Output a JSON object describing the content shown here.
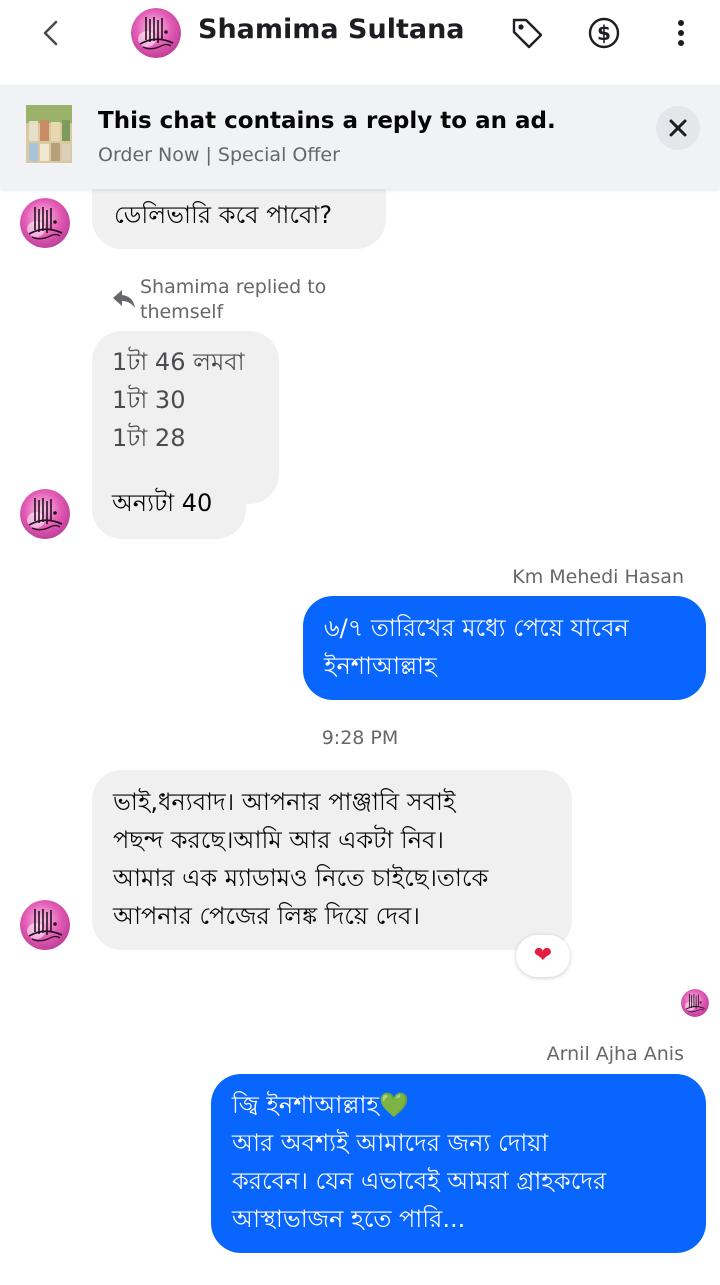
{
  "header": {
    "title": "Shamima Sultana",
    "icons": [
      "back-chevron-icon",
      "tag-icon",
      "dollar-icon",
      "more-vertical-icon"
    ]
  },
  "ad_banner": {
    "title": "This chat contains a reply to an ad.",
    "subtitle": "Order Now | Special Offer"
  },
  "messages": {
    "m1": {
      "text": "ডেলিভারি কবে পাবো?"
    },
    "reply_note": {
      "line1": "Shamima replied to",
      "line2": "themself"
    },
    "m2": {
      "line1": "1টা 46 লমবা",
      "line2": "1টা 30",
      "line3": "1টা 28"
    },
    "m3": {
      "text": "অন্যটা 40"
    },
    "sender_km": "Km Mehedi Hasan",
    "m4": {
      "line1": "৬/৭ তারিখের মধ্যে পেয়ে যাবেন",
      "line2": "ইনশাআল্লাহ"
    },
    "timestamp": "9:28 PM",
    "m5": {
      "line1": "ভাই,ধন্যবাদ। আপনার পাঞ্জাবি সবাই",
      "line2": "পছন্দ করছে।আমি আর একটা নিব।",
      "line3": "আমার এক ম্যাডামও নিতে চাইছে।তাকে",
      "line4": "আপনার পেজের লিঙ্ক দিয়ে দেব।"
    },
    "reaction": "❤",
    "sender_arnil": "Arnil Ajha Anis",
    "m6": {
      "line1": "জ্বি ইনশাআল্লাহ",
      "line1_emoji": "💚",
      "line2": "আর অবশ্যই আমাদের জন্য দোয়া",
      "line3": "করবেন। যেন এভাবেই আমরা গ্রাহকদের",
      "line4": "আস্থাভাজন হতে পারি..."
    }
  },
  "colors": {
    "accent": "#0866ff",
    "incoming_bubble": "#f0f0f0",
    "secondary_text": "#65676b",
    "avatar_pink": "#e35bb5"
  }
}
